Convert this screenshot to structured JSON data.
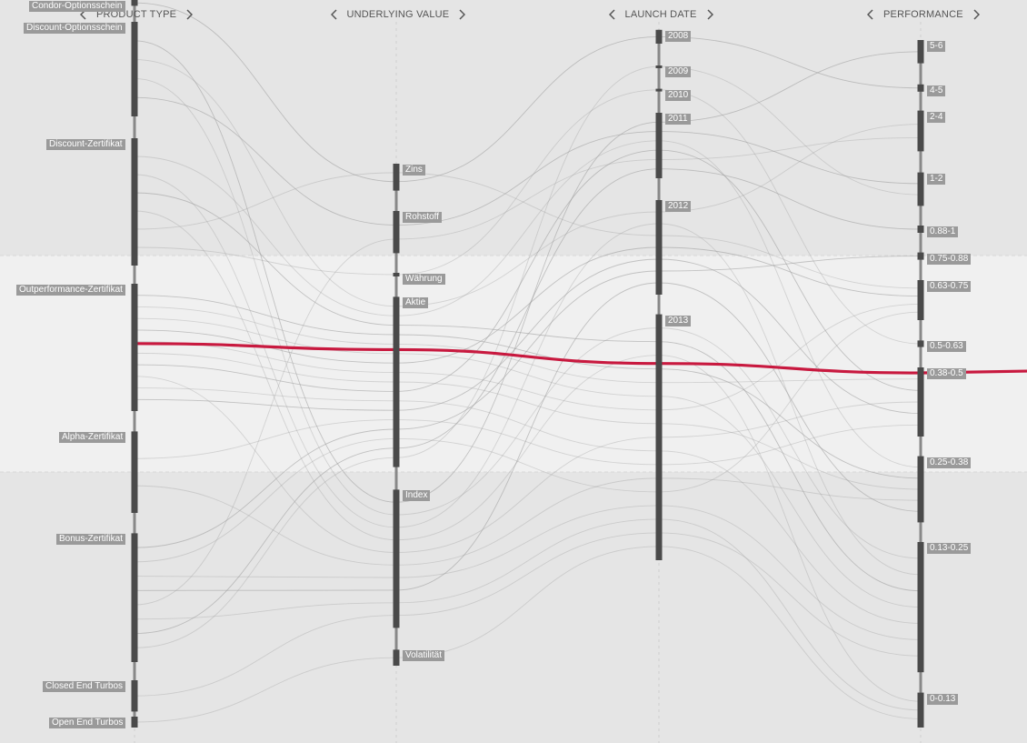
{
  "colors": {
    "background": "#e5e5e5",
    "band": "#f0f0f0",
    "bar": "#4a4a4a",
    "axis_line": "#888888",
    "label_bg": "#9a9a9a",
    "highlight": "#c8193f",
    "line": "#9a9a9a"
  },
  "icons": {
    "prev": "chevron-left-icon",
    "next": "chevron-right-icon"
  },
  "chart_data": {
    "type": "parallel-sets",
    "dimensions": [
      {
        "id": "product_type",
        "title": "PRODUCT TYPE",
        "categories": [
          {
            "label": "Condor-Optionsschein",
            "start": 0.0,
            "end": 0.008
          },
          {
            "label": "Discount-Optionsschein",
            "start": 0.03,
            "end": 0.16
          },
          {
            "label": "Discount-Zertifikat",
            "start": 0.19,
            "end": 0.365
          },
          {
            "label": "Outperformance-Zertifikat",
            "start": 0.39,
            "end": 0.565
          },
          {
            "label": "Alpha-Zertifikat",
            "start": 0.593,
            "end": 0.705
          },
          {
            "label": "Bonus-Zertifikat",
            "start": 0.733,
            "end": 0.91
          },
          {
            "label": "Closed End Turbos",
            "start": 0.935,
            "end": 0.978
          },
          {
            "label": "Open End Turbos",
            "start": 0.985,
            "end": 1.0
          }
        ]
      },
      {
        "id": "underlying_value",
        "title": "UNDERLYING VALUE",
        "categories": [
          {
            "label": "Zins",
            "start": 0.225,
            "end": 0.262
          },
          {
            "label": "Rohstoff",
            "start": 0.29,
            "end": 0.348
          },
          {
            "label": "Währung",
            "start": 0.375,
            "end": 0.38
          },
          {
            "label": "Aktie",
            "start": 0.408,
            "end": 0.642
          },
          {
            "label": "Index",
            "start": 0.673,
            "end": 0.863
          },
          {
            "label": "Volatilität",
            "start": 0.893,
            "end": 0.915
          }
        ]
      },
      {
        "id": "launch_date",
        "title": "LAUNCH DATE",
        "categories": [
          {
            "label": "2008",
            "start": 0.041,
            "end": 0.06
          },
          {
            "label": "2009",
            "start": 0.09,
            "end": 0.093
          },
          {
            "label": "2010",
            "start": 0.122,
            "end": 0.125
          },
          {
            "label": "2011",
            "start": 0.155,
            "end": 0.245
          },
          {
            "label": "2012",
            "start": 0.275,
            "end": 0.405
          },
          {
            "label": "2013",
            "start": 0.432,
            "end": 0.77
          }
        ]
      },
      {
        "id": "performance",
        "title": "PERFORMANCE",
        "categories": [
          {
            "label": "5-6",
            "start": 0.055,
            "end": 0.087
          },
          {
            "label": "4-5",
            "start": 0.116,
            "end": 0.126
          },
          {
            "label": "2-4",
            "start": 0.152,
            "end": 0.208
          },
          {
            "label": "1-2",
            "start": 0.237,
            "end": 0.283
          },
          {
            "label": "0.88-1",
            "start": 0.31,
            "end": 0.32
          },
          {
            "label": "0.75-0.88",
            "start": 0.347,
            "end": 0.357
          },
          {
            "label": "0.63-0.75",
            "start": 0.385,
            "end": 0.44
          },
          {
            "label": "0.5-0.63",
            "start": 0.468,
            "end": 0.477
          },
          {
            "label": "0.38-0.5",
            "start": 0.505,
            "end": 0.6
          },
          {
            "label": "0.25-0.38",
            "start": 0.627,
            "end": 0.718
          },
          {
            "label": "0.13-0.25",
            "start": 0.745,
            "end": 0.924
          },
          {
            "label": "0-0.13",
            "start": 0.952,
            "end": 1.0
          }
        ]
      }
    ],
    "highlighted_path": [
      "Outperformance-Zertifikat",
      "Aktie",
      "2013",
      "0.38-0.5"
    ],
    "ribbons": [
      [
        "Discount-Optionsschein",
        "Index",
        "2011",
        "5-6"
      ],
      [
        "Discount-Optionsschein",
        "Aktie",
        "2012",
        "2-4"
      ],
      [
        "Discount-Optionsschein",
        "Index",
        "2013",
        "0.13-0.25"
      ],
      [
        "Discount-Optionsschein",
        "Rohstoff",
        "2011",
        "1-2"
      ],
      [
        "Discount-Zertifikat",
        "Aktie",
        "2011",
        "0.25-0.38"
      ],
      [
        "Discount-Zertifikat",
        "Index",
        "2012",
        "0.13-0.25"
      ],
      [
        "Discount-Zertifikat",
        "Aktie",
        "2013",
        "0.13-0.25"
      ],
      [
        "Discount-Zertifikat",
        "Index",
        "2013",
        "0-0.13"
      ],
      [
        "Discount-Zertifikat",
        "Zins",
        "2012",
        "0.63-0.75"
      ],
      [
        "Outperformance-Zertifikat",
        "Aktie",
        "2013",
        "0.25-0.38"
      ],
      [
        "Outperformance-Zertifikat",
        "Aktie",
        "2013",
        "0.38-0.5"
      ],
      [
        "Outperformance-Zertifikat",
        "Aktie",
        "2013",
        "0.13-0.25"
      ],
      [
        "Outperformance-Zertifikat",
        "Aktie",
        "2012",
        "0.63-0.75"
      ],
      [
        "Outperformance-Zertifikat",
        "Aktie",
        "2013",
        "0.63-0.75"
      ],
      [
        "Outperformance-Zertifikat",
        "Aktie",
        "2013",
        "0.25-0.38"
      ],
      [
        "Outperformance-Zertifikat",
        "Aktie",
        "2011",
        "0.38-0.5"
      ],
      [
        "Outperformance-Zertifikat",
        "Index",
        "2013",
        "0.38-0.5"
      ],
      [
        "Outperformance-Zertifikat",
        "Aktie",
        "2013",
        "0.13-0.25"
      ],
      [
        "Outperformance-Zertifikat",
        "Aktie",
        "2012",
        "0.38-0.5"
      ],
      [
        "Alpha-Zertifikat",
        "Aktie",
        "2013",
        "0.38-0.5"
      ],
      [
        "Alpha-Zertifikat",
        "Index",
        "2013",
        "0.25-0.38"
      ],
      [
        "Bonus-Zertifikat",
        "Aktie",
        "2012",
        "0.75-0.88"
      ],
      [
        "Bonus-Zertifikat",
        "Aktie",
        "2013",
        "0.63-0.75"
      ],
      [
        "Bonus-Zertifikat",
        "Index",
        "2013",
        "0.13-0.25"
      ],
      [
        "Bonus-Zertifikat",
        "Index",
        "2012",
        "0.25-0.38"
      ],
      [
        "Bonus-Zertifikat",
        "Rohstoff",
        "2011",
        "2-4"
      ],
      [
        "Bonus-Zertifikat",
        "Index",
        "2013",
        "0-0.13"
      ],
      [
        "Bonus-Zertifikat",
        "Aktie",
        "2011",
        "0.88-1"
      ],
      [
        "Closed End Turbos",
        "Index",
        "2013",
        "0.13-0.25"
      ],
      [
        "Open End Turbos",
        "Volatilität",
        "2013",
        "0-0.13"
      ],
      [
        "Condor-Optionsschein",
        "Zins",
        "2008",
        "4-5"
      ],
      [
        "Discount-Zertifikat",
        "Währung",
        "2010",
        "0.5-0.63"
      ],
      [
        "Bonus-Zertifikat",
        "Aktie",
        "2009",
        "1-2"
      ]
    ]
  }
}
